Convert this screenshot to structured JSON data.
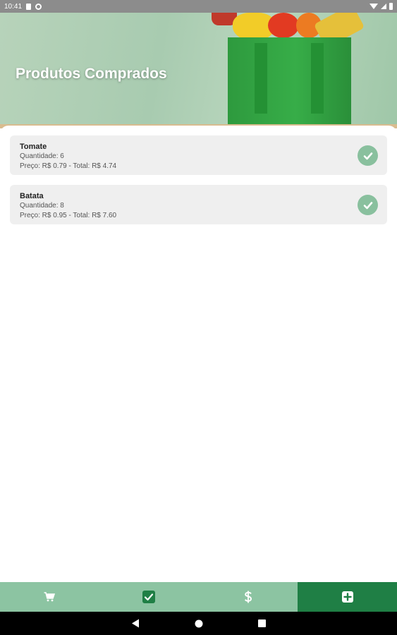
{
  "status_bar": {
    "time": "10:41",
    "left_icons": [
      "sim-card-icon",
      "sync-icon"
    ],
    "right_icons": [
      "wifi-icon",
      "signal-icon",
      "battery-icon"
    ]
  },
  "header": {
    "title": "Produtos Comprados",
    "background_image": "grocery-bag-with-produce",
    "colors": {
      "background": "#b0d0b6",
      "bag": "#2e9a3e"
    }
  },
  "products": [
    {
      "name": "Tomate",
      "quantity_line": "Quantidade: 6",
      "price_line": "Preço: R$ 0.79 - Total: R$ 4.74",
      "status_icon": "check-circle-icon"
    },
    {
      "name": "Batata",
      "quantity_line": "Quantidade: 8",
      "price_line": "Preço: R$ 0.95 - Total: R$ 7.60",
      "status_icon": "check-circle-icon"
    }
  ],
  "bottom_nav": {
    "tabs": [
      {
        "icon": "cart-icon",
        "active": false
      },
      {
        "icon": "check-square-icon",
        "active": false
      },
      {
        "icon": "dollar-icon",
        "active": false
      },
      {
        "icon": "plus-square-icon",
        "active": true
      }
    ],
    "colors": {
      "bar": "#8cc4a2",
      "active": "#1f7f45"
    }
  },
  "system_nav": {
    "buttons": [
      "back-icon",
      "home-icon",
      "recents-icon"
    ]
  }
}
